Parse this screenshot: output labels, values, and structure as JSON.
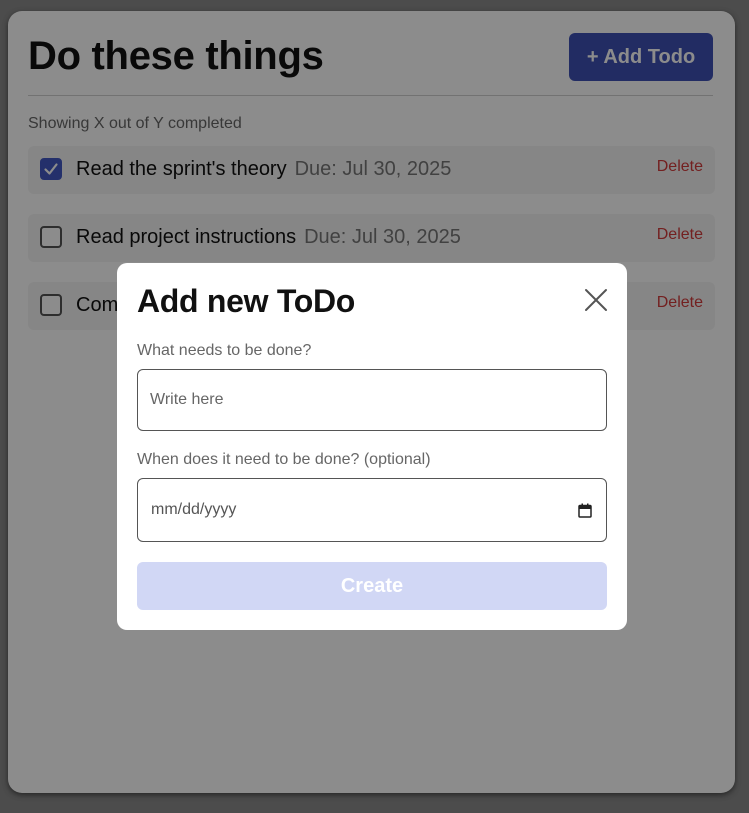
{
  "page": {
    "title": "Do these things",
    "add_button": "+ Add Todo",
    "summary": "Showing X out of Y completed"
  },
  "todos": [
    {
      "text": "Read the sprint's theory",
      "due": "Due: Jul 30, 2025",
      "completed": true,
      "delete_label": "Delete"
    },
    {
      "text": "Read project instructions",
      "due": "Due: Jul 30, 2025",
      "completed": false,
      "delete_label": "Delete"
    },
    {
      "text": "Com",
      "due": "",
      "completed": false,
      "delete_label": "Delete"
    }
  ],
  "modal": {
    "title": "Add new ToDo",
    "name_label": "What needs to be done?",
    "name_placeholder": "Write here",
    "name_value": "",
    "date_label": "When does it need to be done? (optional)",
    "date_placeholder": "mm/dd/yyyy",
    "create_label": "Create",
    "close_icon": "close-icon",
    "calendar_icon": "calendar-icon"
  },
  "colors": {
    "accent": "#3f51b5",
    "accent_disabled": "#d1d7f5",
    "danger": "#d23b3b",
    "overlay": "rgba(0,0,0,0.45)"
  }
}
